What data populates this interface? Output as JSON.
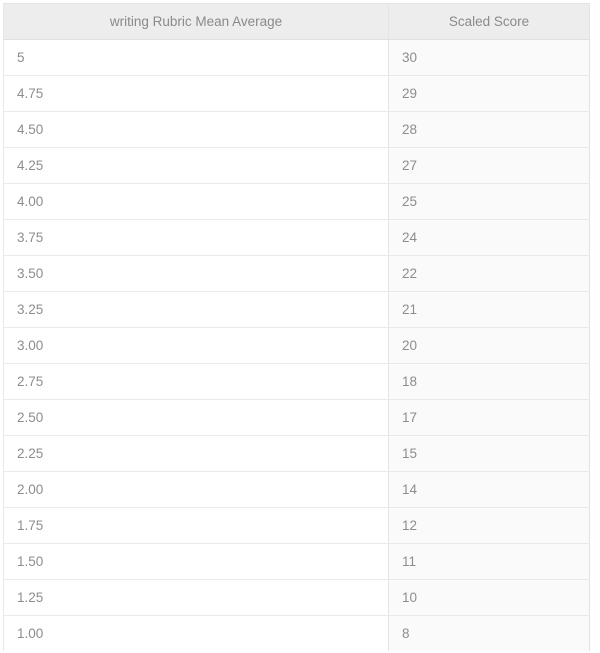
{
  "table": {
    "columns": [
      {
        "key": "rubric",
        "label": "writing Rubric Mean Average"
      },
      {
        "key": "scaled",
        "label": "Scaled Score"
      }
    ],
    "rows": [
      {
        "rubric": "5",
        "scaled": "30"
      },
      {
        "rubric": "4.75",
        "scaled": "29"
      },
      {
        "rubric": "4.50",
        "scaled": "28"
      },
      {
        "rubric": "4.25",
        "scaled": "27"
      },
      {
        "rubric": "4.00",
        "scaled": "25"
      },
      {
        "rubric": "3.75",
        "scaled": "24"
      },
      {
        "rubric": "3.50",
        "scaled": "22"
      },
      {
        "rubric": "3.25",
        "scaled": "21"
      },
      {
        "rubric": "3.00",
        "scaled": "20"
      },
      {
        "rubric": "2.75",
        "scaled": "18"
      },
      {
        "rubric": "2.50",
        "scaled": "17"
      },
      {
        "rubric": "2.25",
        "scaled": "15"
      },
      {
        "rubric": "2.00",
        "scaled": "14"
      },
      {
        "rubric": "1.75",
        "scaled": "12"
      },
      {
        "rubric": "1.50",
        "scaled": "11"
      },
      {
        "rubric": "1.25",
        "scaled": "10"
      },
      {
        "rubric": "1.00",
        "scaled": "8"
      }
    ]
  },
  "colors": {
    "header_background": "#ededed",
    "header_text": "#8a8a8a",
    "cell_text": "#8d8d8d",
    "row_border": "#eaeaea",
    "column_border": "#e4e4e4",
    "column_one_background": "#ffffff",
    "column_two_background": "#fafafa",
    "page_background": "#ffffff"
  }
}
